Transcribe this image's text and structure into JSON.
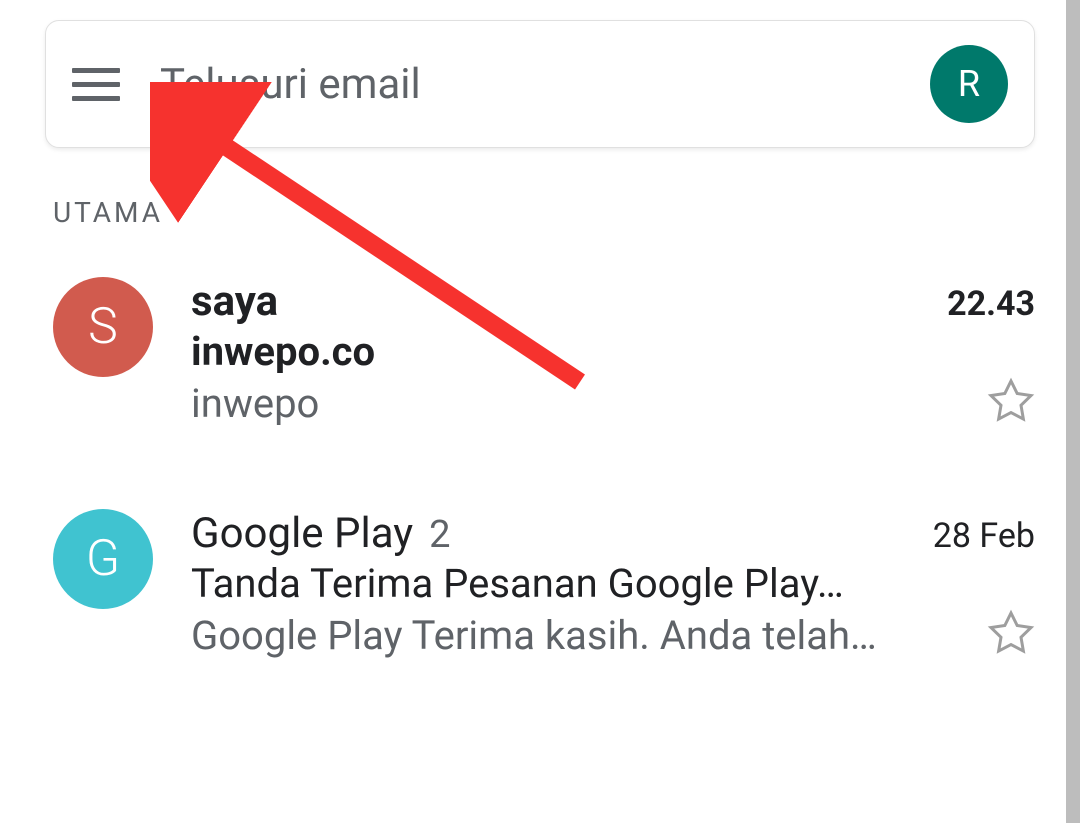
{
  "search": {
    "placeholder": "Telusuri email",
    "avatar_initial": "R"
  },
  "section_label": "UTAMA",
  "emails": [
    {
      "avatar_initial": "S",
      "avatar_color": "red",
      "sender": "saya",
      "thread_count": "",
      "time": "22.43",
      "subject": "inwepo.co",
      "snippet": "inwepo",
      "unread": true
    },
    {
      "avatar_initial": "G",
      "avatar_color": "teal",
      "sender": "Google Play",
      "thread_count": "2",
      "time": "28 Feb",
      "subject": "Tanda Terima Pesanan Google Play…",
      "snippet": "Google Play Terima kasih. Anda telah…",
      "unread": false
    }
  ]
}
